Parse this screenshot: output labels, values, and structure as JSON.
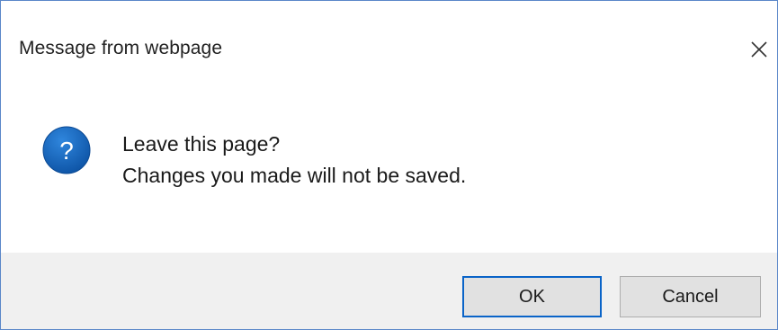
{
  "dialog": {
    "title": "Message from webpage",
    "close_icon": "close-icon",
    "question_icon": "question-icon",
    "question_glyph": "?",
    "message_line1": "Leave this page?",
    "message_line2": "Changes you made will not be saved.",
    "ok_label": "OK",
    "cancel_label": "Cancel"
  },
  "colors": {
    "icon_blue": "#1565c0",
    "ok_border": "#0a64c8",
    "footer_bg": "#f0f0f0",
    "window_border": "#5b87c9"
  }
}
